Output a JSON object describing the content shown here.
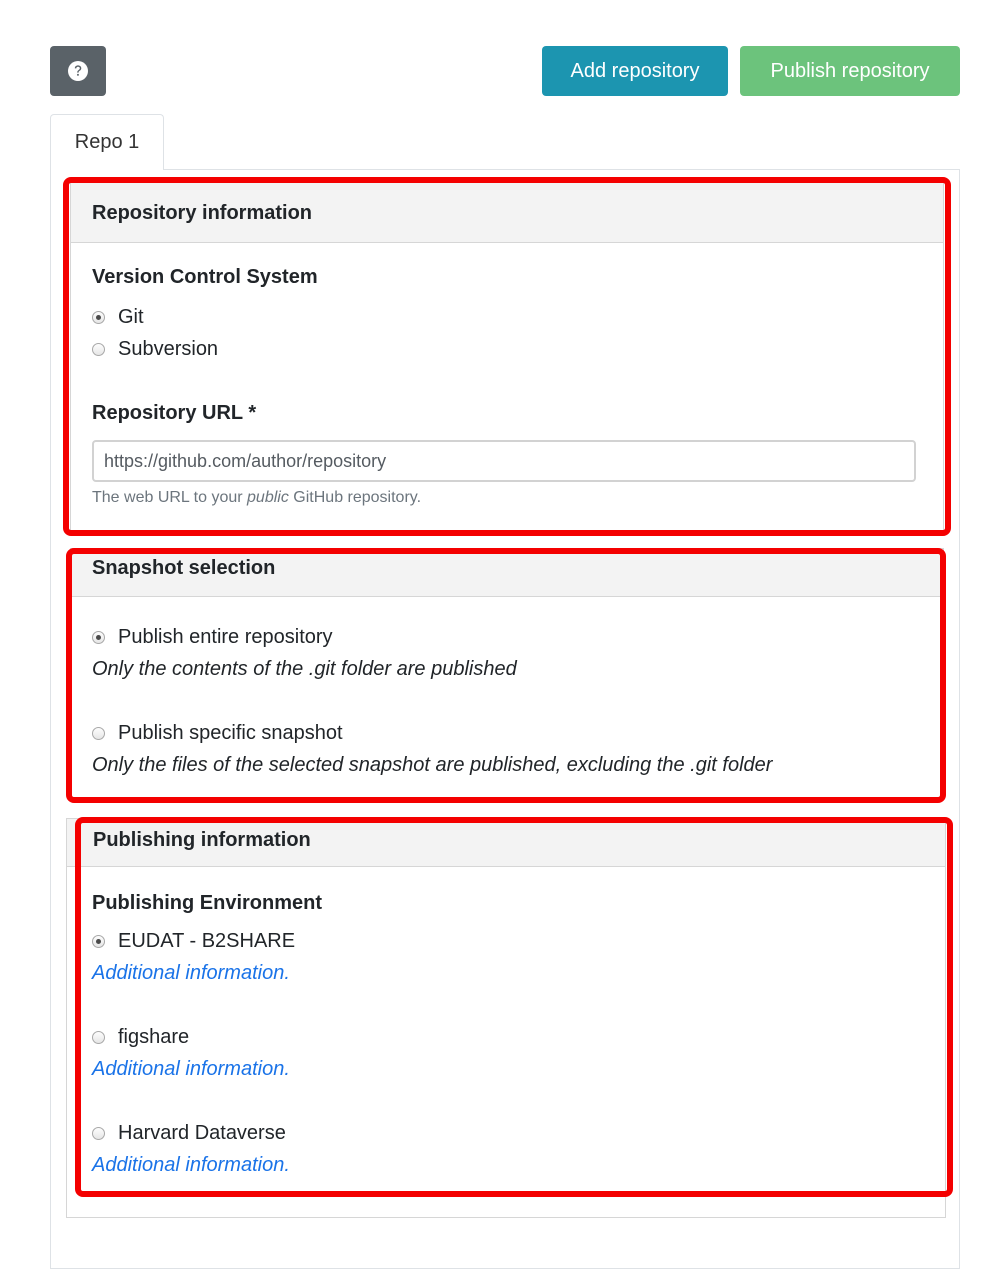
{
  "toolbar": {
    "help_icon": "question-circle-icon",
    "add_label": "Add repository",
    "publish_label": "Publish repository",
    "colors": {
      "help_bg": "#5a6268",
      "add_bg": "#1c95b0",
      "publish_bg": "#6cc37c",
      "highlight": "#f40000"
    }
  },
  "tabs": [
    {
      "label": "Repo 1",
      "active": true
    }
  ],
  "repository_info": {
    "header": "Repository information",
    "vcs_label": "Version Control System",
    "vcs_options": [
      {
        "label": "Git",
        "checked": true
      },
      {
        "label": "Subversion",
        "checked": false
      }
    ],
    "url_label": "Repository URL *",
    "url_placeholder": "https://github.com/author/repository",
    "url_help_prefix": "The web URL to your ",
    "url_help_emph": "public",
    "url_help_suffix": " GitHub repository."
  },
  "snapshot": {
    "header": "Snapshot selection",
    "options": [
      {
        "label": "Publish entire repository",
        "checked": true,
        "note": "Only the contents of the .git folder are published"
      },
      {
        "label": "Publish specific snapshot",
        "checked": false,
        "note": "Only the files of the selected snapshot are published, excluding the .git folder"
      }
    ]
  },
  "publishing": {
    "header": "Publishing information",
    "env_label": "Publishing Environment",
    "options": [
      {
        "label": "EUDAT - B2SHARE",
        "checked": true,
        "link": "Additional information."
      },
      {
        "label": "figshare",
        "checked": false,
        "link": "Additional information."
      },
      {
        "label": "Harvard Dataverse",
        "checked": false,
        "link": "Additional information."
      }
    ]
  }
}
